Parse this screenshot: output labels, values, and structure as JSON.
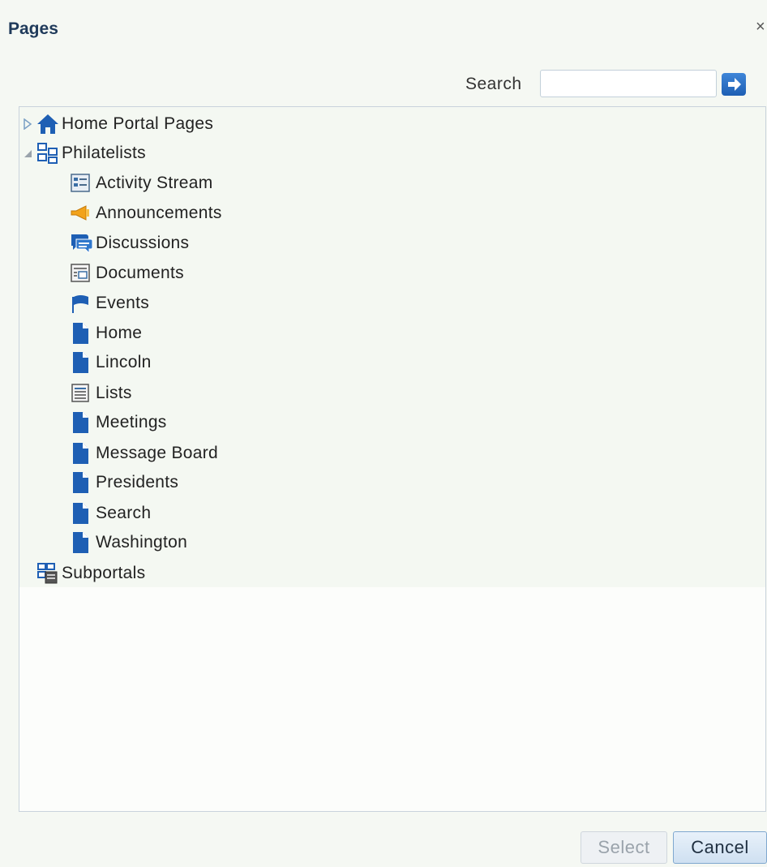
{
  "dialog": {
    "title": "Pages",
    "close_label": "×"
  },
  "search": {
    "label": "Search",
    "value": "",
    "placeholder": ""
  },
  "tree": {
    "root_items": [
      {
        "label": "Home Portal Pages",
        "icon": "home-icon",
        "state": "collapsed"
      },
      {
        "label": "Philatelists",
        "icon": "portal-icon",
        "state": "expanded"
      },
      {
        "label": "Subportals",
        "icon": "subportals-icon",
        "state": "leaf"
      }
    ],
    "children": [
      {
        "label": "Activity Stream",
        "icon": "activity-stream-icon"
      },
      {
        "label": "Announcements",
        "icon": "megaphone-icon"
      },
      {
        "label": "Discussions",
        "icon": "discussions-icon"
      },
      {
        "label": "Documents",
        "icon": "documents-icon"
      },
      {
        "label": "Events",
        "icon": "flag-icon"
      },
      {
        "label": "Home",
        "icon": "page-icon"
      },
      {
        "label": "Lincoln",
        "icon": "page-icon"
      },
      {
        "label": "Lists",
        "icon": "list-icon"
      },
      {
        "label": "Meetings",
        "icon": "page-icon"
      },
      {
        "label": "Message Board",
        "icon": "page-icon"
      },
      {
        "label": "Presidents",
        "icon": "page-icon"
      },
      {
        "label": "Search",
        "icon": "page-icon"
      },
      {
        "label": "Washington",
        "icon": "page-icon"
      }
    ]
  },
  "buttons": {
    "select": "Select",
    "cancel": "Cancel"
  },
  "colors": {
    "accent": "#1e5fb4",
    "title": "#1f3a5a",
    "background": "#f5f8f3"
  }
}
